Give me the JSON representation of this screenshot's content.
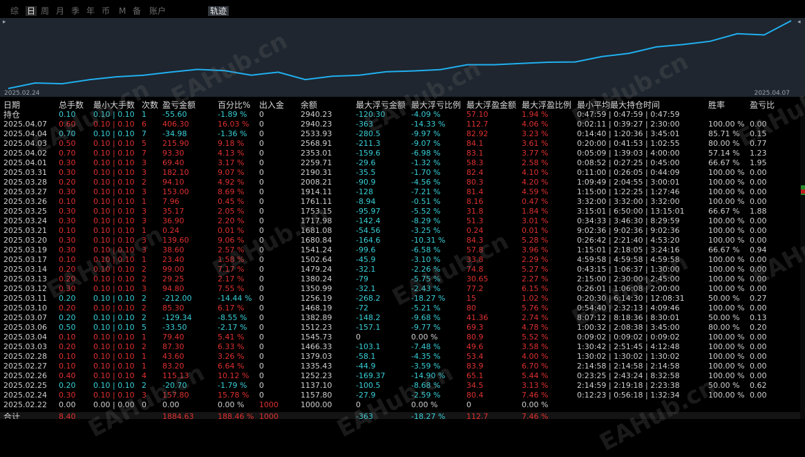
{
  "tabs": [
    {
      "label": "综",
      "active": false
    },
    {
      "label": "日",
      "active": true
    },
    {
      "label": "周",
      "active": false
    },
    {
      "label": "月",
      "active": false
    },
    {
      "label": "季",
      "active": false
    },
    {
      "label": "年",
      "active": false
    },
    {
      "label": "币",
      "active": false
    },
    {
      "label": "M",
      "active": false
    },
    {
      "label": "备",
      "active": false
    },
    {
      "label": "账户",
      "active": false
    }
  ],
  "track_tab": "轨迹",
  "chart": {
    "start_label": "2025.02.24",
    "end_label": "2025.04.07",
    "line_color": "#20b0f0",
    "balances": [
      1000.0,
      1157.8,
      1137.1,
      1252.23,
      1335.43,
      1379.03,
      1466.33,
      1545.73,
      1512.23,
      1382.89,
      1468.19,
      1256.19,
      1350.99,
      1380.24,
      1479.24,
      1502.64,
      1541.24,
      1680.84,
      1681.08,
      1717.98,
      1753.15,
      1761.11,
      1914.11,
      2008.21,
      2190.31,
      2259.71,
      2353.01,
      2568.91,
      2533.93,
      2940.23
    ]
  },
  "columns": {
    "date": "日期",
    "total_lots": "总手数",
    "min_max_lots": "最小大手数",
    "count": "次数",
    "pnl": "盈亏金额",
    "pct": "百分比%",
    "in_out": "出入金",
    "balance": "余额",
    "max_float_loss": "最大浮亏金额",
    "max_float_loss_pct": "最大浮亏比例",
    "max_float_profit": "最大浮盈金额",
    "max_float_profit_pct": "最大浮盈比例",
    "hold_time": "最小平均最大持仓时间",
    "win_rate": "胜率",
    "pl_ratio": "盈亏比"
  },
  "rows": [
    {
      "date": "持仓",
      "total_lots": "0.10",
      "min_max": "0.10 | 0.10",
      "count": "1",
      "pnl": "-55.60",
      "pct": "-1.89 %",
      "in_out": "0",
      "balance": "2940.23",
      "mfl": "-120.30",
      "mflp": "-4.09 %",
      "mfp": "57.10",
      "mfpp": "1.94 %",
      "hold": "0:47:59 | 0:47:59 | 0:47:59",
      "win": "",
      "plr": "",
      "color": "g"
    },
    {
      "date": "2025.04.07",
      "total_lots": "0.60",
      "min_max": "0.10 | 0.10",
      "count": "6",
      "pnl": "406.30",
      "pct": "16.03 %",
      "in_out": "0",
      "balance": "2940.23",
      "mfl": "-363",
      "mflp": "-14.33 %",
      "mfp": "112.7",
      "mfpp": "4.06 %",
      "hold": "0:02:11 | 0:39:27 | 2:30:00",
      "win": "100.00 %",
      "plr": "0.00",
      "color": "r"
    },
    {
      "date": "2025.04.04",
      "total_lots": "0.70",
      "min_max": "0.10 | 0.10",
      "count": "7",
      "pnl": "-34.98",
      "pct": "-1.36 %",
      "in_out": "0",
      "balance": "2533.93",
      "mfl": "-280.5",
      "mflp": "-9.97 %",
      "mfp": "82.92",
      "mfpp": "3.23 %",
      "hold": "0:14:40 | 1:20:36 | 3:45:01",
      "win": "85.71 %",
      "plr": "0.15",
      "color": "g"
    },
    {
      "date": "2025.04.03",
      "total_lots": "0.50",
      "min_max": "0.10 | 0.10",
      "count": "5",
      "pnl": "215.90",
      "pct": "9.18 %",
      "in_out": "0",
      "balance": "2568.91",
      "mfl": "-211.3",
      "mflp": "-9.07 %",
      "mfp": "84.1",
      "mfpp": "3.61 %",
      "hold": "0:20:00 | 0:41:53 | 1:02:55",
      "win": "80.00 %",
      "plr": "0.77",
      "color": "r"
    },
    {
      "date": "2025.04.02",
      "total_lots": "0.70",
      "min_max": "0.10 | 0.10",
      "count": "7",
      "pnl": "93.30",
      "pct": "4.13 %",
      "in_out": "0",
      "balance": "2353.01",
      "mfl": "-159.6",
      "mflp": "-6.98 %",
      "mfp": "83.1",
      "mfpp": "3.77 %",
      "hold": "0:05:09 | 1:39:03 | 4:00:00",
      "win": "57.14 %",
      "plr": "1.23",
      "color": "r"
    },
    {
      "date": "2025.04.01",
      "total_lots": "0.30",
      "min_max": "0.10 | 0.10",
      "count": "3",
      "pnl": "69.40",
      "pct": "3.17 %",
      "in_out": "0",
      "balance": "2259.71",
      "mfl": "-29.6",
      "mflp": "-1.32 %",
      "mfp": "58.3",
      "mfpp": "2.58 %",
      "hold": "0:08:52 | 0:27:25 | 0:45:00",
      "win": "66.67 %",
      "plr": "1.95",
      "color": "r"
    },
    {
      "date": "2025.03.31",
      "total_lots": "0.30",
      "min_max": "0.10 | 0.10",
      "count": "3",
      "pnl": "182.10",
      "pct": "9.07 %",
      "in_out": "0",
      "balance": "2190.31",
      "mfl": "-35.5",
      "mflp": "-1.70 %",
      "mfp": "82.4",
      "mfpp": "4.10 %",
      "hold": "0:11:00 | 0:26:05 | 0:44:09",
      "win": "100.00 %",
      "plr": "0.00",
      "color": "r"
    },
    {
      "date": "2025.03.28",
      "total_lots": "0.20",
      "min_max": "0.10 | 0.10",
      "count": "2",
      "pnl": "94.10",
      "pct": "4.92 %",
      "in_out": "0",
      "balance": "2008.21",
      "mfl": "-90.9",
      "mflp": "-4.56 %",
      "mfp": "80.3",
      "mfpp": "4.20 %",
      "hold": "1:09:49 | 2:04:55 | 3:00:01",
      "win": "100.00 %",
      "plr": "0.00",
      "color": "r"
    },
    {
      "date": "2025.03.27",
      "total_lots": "0.30",
      "min_max": "0.10 | 0.10",
      "count": "3",
      "pnl": "153.00",
      "pct": "8.69 %",
      "in_out": "0",
      "balance": "1914.11",
      "mfl": "-128",
      "mflp": "-7.21 %",
      "mfp": "81.4",
      "mfpp": "4.59 %",
      "hold": "1:15:00 | 1:22:25 | 1:27:46",
      "win": "100.00 %",
      "plr": "0.00",
      "color": "r"
    },
    {
      "date": "2025.03.26",
      "total_lots": "0.10",
      "min_max": "0.10 | 0.10",
      "count": "1",
      "pnl": "7.96",
      "pct": "0.45 %",
      "in_out": "0",
      "balance": "1761.11",
      "mfl": "-8.94",
      "mflp": "-0.51 %",
      "mfp": "8.16",
      "mfpp": "0.47 %",
      "hold": "3:32:00 | 3:32:00 | 3:32:00",
      "win": "100.00 %",
      "plr": "0.00",
      "color": "r"
    },
    {
      "date": "2025.03.25",
      "total_lots": "0.30",
      "min_max": "0.10 | 0.10",
      "count": "3",
      "pnl": "35.17",
      "pct": "2.05 %",
      "in_out": "0",
      "balance": "1753.15",
      "mfl": "-95.97",
      "mflp": "-5.52 %",
      "mfp": "31.8",
      "mfpp": "1.84 %",
      "hold": "3:15:01 | 6:50:00 | 13:15:01",
      "win": "66.67 %",
      "plr": "1.88",
      "color": "r"
    },
    {
      "date": "2025.03.24",
      "total_lots": "0.30",
      "min_max": "0.10 | 0.10",
      "count": "3",
      "pnl": "36.90",
      "pct": "2.20 %",
      "in_out": "0",
      "balance": "1717.98",
      "mfl": "-142.4",
      "mflp": "-8.29 %",
      "mfp": "51.3",
      "mfpp": "3.01 %",
      "hold": "0:34:33 | 3:46:30 | 8:29:59",
      "win": "100.00 %",
      "plr": "0.00",
      "color": "r"
    },
    {
      "date": "2025.03.21",
      "total_lots": "0.10",
      "min_max": "0.10 | 0.10",
      "count": "1",
      "pnl": "0.24",
      "pct": "0.01 %",
      "in_out": "0",
      "balance": "1681.08",
      "mfl": "-54.56",
      "mflp": "-3.25 %",
      "mfp": "0.24",
      "mfpp": "0.01 %",
      "hold": "9:02:36 | 9:02:36 | 9:02:36",
      "win": "100.00 %",
      "plr": "0.00",
      "color": "r"
    },
    {
      "date": "2025.03.20",
      "total_lots": "0.30",
      "min_max": "0.10 | 0.10",
      "count": "3",
      "pnl": "139.60",
      "pct": "9.06 %",
      "in_out": "0",
      "balance": "1680.84",
      "mfl": "-164.6",
      "mflp": "-10.31 %",
      "mfp": "84.3",
      "mfpp": "5.28 %",
      "hold": "0:26:42 | 2:21:40 | 4:53:20",
      "win": "100.00 %",
      "plr": "0.00",
      "color": "r"
    },
    {
      "date": "2025.03.19",
      "total_lots": "0.30",
      "min_max": "0.10 | 0.10",
      "count": "3",
      "pnl": "38.60",
      "pct": "2.57 %",
      "in_out": "0",
      "balance": "1541.24",
      "mfl": "-99.6",
      "mflp": "-6.58 %",
      "mfp": "57.8",
      "mfpp": "3.96 %",
      "hold": "1:15:01 | 2:18:05 | 3:24:16",
      "win": "66.67 %",
      "plr": "0.94",
      "color": "r"
    },
    {
      "date": "2025.03.17",
      "total_lots": "0.10",
      "min_max": "0.10 | 0.10",
      "count": "1",
      "pnl": "23.40",
      "pct": "1.58 %",
      "in_out": "0",
      "balance": "1502.64",
      "mfl": "-45.9",
      "mflp": "-3.10 %",
      "mfp": "33.8",
      "mfpp": "2.29 %",
      "hold": "4:59:58 | 4:59:58 | 4:59:58",
      "win": "100.00 %",
      "plr": "0.00",
      "color": "r"
    },
    {
      "date": "2025.03.14",
      "total_lots": "0.20",
      "min_max": "0.10 | 0.10",
      "count": "2",
      "pnl": "99.00",
      "pct": "7.17 %",
      "in_out": "0",
      "balance": "1479.24",
      "mfl": "-32.1",
      "mflp": "-2.26 %",
      "mfp": "74.8",
      "mfpp": "5.27 %",
      "hold": "0:43:15 | 1:06:37 | 1:30:00",
      "win": "100.00 %",
      "plr": "0.00",
      "color": "r"
    },
    {
      "date": "2025.03.13",
      "total_lots": "0.20",
      "min_max": "0.10 | 0.10",
      "count": "2",
      "pnl": "29.25",
      "pct": "2.17 %",
      "in_out": "0",
      "balance": "1380.24",
      "mfl": "-79",
      "mflp": "-5.75 %",
      "mfp": "30.65",
      "mfpp": "2.27 %",
      "hold": "2:15:00 | 2:30:00 | 2:45:00",
      "win": "100.00 %",
      "plr": "0.00",
      "color": "r"
    },
    {
      "date": "2025.03.12",
      "total_lots": "0.30",
      "min_max": "0.10 | 0.10",
      "count": "3",
      "pnl": "94.80",
      "pct": "7.55 %",
      "in_out": "0",
      "balance": "1350.99",
      "mfl": "-32.1",
      "mflp": "-2.43 %",
      "mfp": "77.2",
      "mfpp": "6.15 %",
      "hold": "0:26:01 | 1:06:08 | 2:00:00",
      "win": "100.00 %",
      "plr": "0.00",
      "color": "r"
    },
    {
      "date": "2025.03.11",
      "total_lots": "0.20",
      "min_max": "0.10 | 0.10",
      "count": "2",
      "pnl": "-212.00",
      "pct": "-14.44 %",
      "in_out": "0",
      "balance": "1256.19",
      "mfl": "-268.2",
      "mflp": "-18.27 %",
      "mfp": "15",
      "mfpp": "1.02 %",
      "hold": "0:20:30 | 6:14:30 | 12:08:31",
      "win": "50.00 %",
      "plr": "0.27",
      "color": "g"
    },
    {
      "date": "2025.03.10",
      "total_lots": "0.20",
      "min_max": "0.10 | 0.10",
      "count": "2",
      "pnl": "85.30",
      "pct": "6.17 %",
      "in_out": "0",
      "balance": "1468.19",
      "mfl": "-72",
      "mflp": "-5.21 %",
      "mfp": "80",
      "mfpp": "5.76 %",
      "hold": "0:54:40 | 2:32:13 | 4:09:46",
      "win": "100.00 %",
      "plr": "0.00",
      "color": "r"
    },
    {
      "date": "2025.03.07",
      "total_lots": "0.20",
      "min_max": "0.10 | 0.10",
      "count": "2",
      "pnl": "-129.34",
      "pct": "-8.55 %",
      "in_out": "0",
      "balance": "1382.89",
      "mfl": "-148.2",
      "mflp": "-9.68 %",
      "mfp": "41.36",
      "mfpp": "2.74 %",
      "hold": "8:07:12 | 8:18:36 | 8:30:01",
      "win": "50.00 %",
      "plr": "0.13",
      "color": "g"
    },
    {
      "date": "2025.03.06",
      "total_lots": "0.50",
      "min_max": "0.10 | 0.10",
      "count": "5",
      "pnl": "-33.50",
      "pct": "-2.17 %",
      "in_out": "0",
      "balance": "1512.23",
      "mfl": "-157.1",
      "mflp": "-9.77 %",
      "mfp": "69.3",
      "mfpp": "4.78 %",
      "hold": "1:00:32 | 2:08:38 | 3:45:00",
      "win": "80.00 %",
      "plr": "0.20",
      "color": "g"
    },
    {
      "date": "2025.03.04",
      "total_lots": "0.10",
      "min_max": "0.10 | 0.10",
      "count": "1",
      "pnl": "79.40",
      "pct": "5.41 %",
      "in_out": "0",
      "balance": "1545.73",
      "mfl": "0",
      "mflp": "0.00 %",
      "mfp": "80.9",
      "mfpp": "5.52 %",
      "hold": "0:09:02 | 0:09:02 | 0:09:02",
      "win": "100.00 %",
      "plr": "0.00",
      "color": "r"
    },
    {
      "date": "2025.03.03",
      "total_lots": "0.20",
      "min_max": "0.10 | 0.10",
      "count": "2",
      "pnl": "87.30",
      "pct": "6.33 %",
      "in_out": "0",
      "balance": "1466.33",
      "mfl": "-103.1",
      "mflp": "-7.48 %",
      "mfp": "49.6",
      "mfpp": "3.58 %",
      "hold": "1:30:42 | 2:51:45 | 4:12:48",
      "win": "100.00 %",
      "plr": "0.00",
      "color": "r"
    },
    {
      "date": "2025.02.28",
      "total_lots": "0.10",
      "min_max": "0.10 | 0.10",
      "count": "1",
      "pnl": "43.60",
      "pct": "3.26 %",
      "in_out": "0",
      "balance": "1379.03",
      "mfl": "-58.1",
      "mflp": "-4.35 %",
      "mfp": "53.4",
      "mfpp": "4.00 %",
      "hold": "1:30:02 | 1:30:02 | 1:30:02",
      "win": "100.00 %",
      "plr": "0.00",
      "color": "r"
    },
    {
      "date": "2025.02.27",
      "total_lots": "0.10",
      "min_max": "0.10 | 0.10",
      "count": "1",
      "pnl": "83.20",
      "pct": "6.64 %",
      "in_out": "0",
      "balance": "1335.43",
      "mfl": "-44.9",
      "mflp": "-3.59 %",
      "mfp": "83.9",
      "mfpp": "6.70 %",
      "hold": "2:14:58 | 2:14:58 | 2:14:58",
      "win": "100.00 %",
      "plr": "0.00",
      "color": "r"
    },
    {
      "date": "2025.02.26",
      "total_lots": "0.40",
      "min_max": "0.10 | 0.10",
      "count": "4",
      "pnl": "115.13",
      "pct": "10.12 %",
      "in_out": "0",
      "balance": "1252.23",
      "mfl": "-169.37",
      "mflp": "-14.90 %",
      "mfp": "65.1",
      "mfpp": "5.44 %",
      "hold": "0:23:25 | 2:43:24 | 8:32:58",
      "win": "100.00 %",
      "plr": "0.00",
      "color": "r"
    },
    {
      "date": "2025.02.25",
      "total_lots": "0.20",
      "min_max": "0.10 | 0.10",
      "count": "2",
      "pnl": "-20.70",
      "pct": "-1.79 %",
      "in_out": "0",
      "balance": "1137.10",
      "mfl": "-100.5",
      "mflp": "-8.68 %",
      "mfp": "34.5",
      "mfpp": "3.13 %",
      "hold": "2:14:59 | 2:19:18 | 2:23:38",
      "win": "50.00 %",
      "plr": "0.62",
      "color": "g"
    },
    {
      "date": "2025.02.24",
      "total_lots": "0.30",
      "min_max": "0.10 | 0.10",
      "count": "3",
      "pnl": "157.80",
      "pct": "15.78 %",
      "in_out": "0",
      "balance": "1157.80",
      "mfl": "-27.9",
      "mflp": "-2.59 %",
      "mfp": "80.4",
      "mfpp": "7.46 %",
      "hold": "0:12:23 | 0:56:18 | 1:32:34",
      "win": "100.00 %",
      "plr": "0.00",
      "color": "r"
    },
    {
      "date": "2025.02.22",
      "total_lots": "0.00",
      "min_max": "0.00 | 0.00",
      "count": "0",
      "pnl": "0.00",
      "pct": "0.00 %",
      "in_out": "1000",
      "balance": "1000.00",
      "mfl": "0",
      "mflp": "0.00 %",
      "mfp": "0",
      "mfpp": "0.00 %",
      "hold": "",
      "win": "",
      "plr": "",
      "color": "w"
    }
  ],
  "total": {
    "label": "合计",
    "total_lots": "8.40",
    "pnl": "1884.63",
    "pct": "188.46 %",
    "in_out": "1000",
    "mfl": "-363",
    "mflp": "-18.27 %",
    "mfp": "112.7",
    "mfpp": "7.46 %"
  },
  "watermark": "EAHub.cn"
}
